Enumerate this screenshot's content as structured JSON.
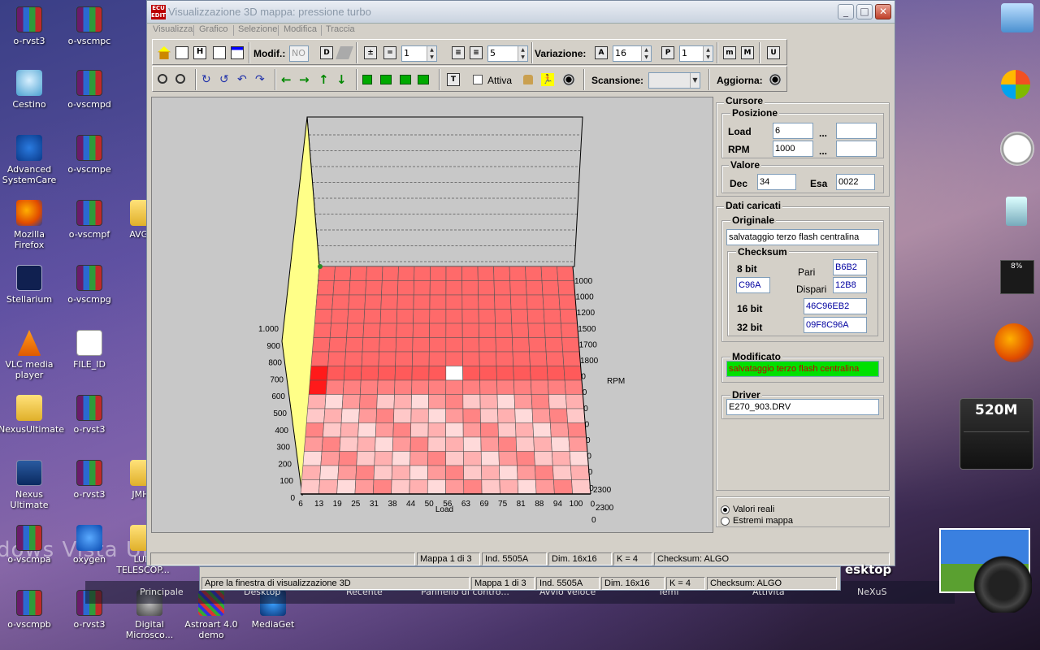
{
  "window": {
    "title": "Visualizzazione 3D mappa: pressione turbo",
    "app_icon_text": "ECU EDIT"
  },
  "menu": [
    "Visualizza",
    "Grafico",
    "Selezione",
    "Modifica",
    "Traccia"
  ],
  "toolbar1": {
    "modif_label": "Modif.:",
    "modif_value": "NO",
    "spin1_value": "1",
    "spin2_value": "5",
    "variazione_label": "Variazione:",
    "variazione_value": "16",
    "p_value": "1"
  },
  "toolbar2": {
    "attiva_label": "Attiva",
    "scansione_label": "Scansione:",
    "scansione_value": "",
    "aggiorna_label": "Aggiorna:"
  },
  "chart_data": {
    "type": "3d-surface",
    "z_ticks": [
      "0",
      "100",
      "200",
      "300",
      "400",
      "500",
      "600",
      "700",
      "800",
      "900",
      "1.000"
    ],
    "load_ticks": [
      "6",
      "13",
      "19",
      "25",
      "31",
      "38",
      "44",
      "50",
      "56",
      "63",
      "69",
      "75",
      "81",
      "88",
      "94",
      "100"
    ],
    "xlabel": "Load",
    "rpm_ticks": [
      "1000",
      "1000",
      "1200",
      "1500",
      "1700",
      "1800",
      "0",
      "0",
      "0",
      "0",
      "0",
      "0",
      "0",
      "0",
      "0",
      "0",
      "2300",
      "2300"
    ],
    "ylabel": "RPM"
  },
  "cursore": {
    "title": "Cursore",
    "posizione_title": "Posizione",
    "load_label": "Load",
    "load_value": "6",
    "load_to": "",
    "rpm_label": "RPM",
    "rpm_value": "1000",
    "rpm_to": "",
    "ellipsis": "...",
    "valore_title": "Valore",
    "dec_label": "Dec",
    "dec_value": "34",
    "esa_label": "Esa",
    "esa_value": "0022"
  },
  "dati": {
    "title": "Dati caricati",
    "originale_title": "Originale",
    "originale_value": "salvataggio terzo flash centralina",
    "checksum_title": "Checksum",
    "bit8_label": "8 bit",
    "pari_label": "Pari",
    "pari_value": "B6B2",
    "bit8_value": "C96A",
    "dispari_label": "Dispari",
    "dispari_value": "12B8",
    "bit16_label": "16 bit",
    "bit16_value": "46C96EB2",
    "bit32_label": "32 bit",
    "bit32_value": "09F8C96A",
    "modificato_title": "Modificato",
    "modificato_value": "salvataggio terzo flash centralina",
    "driver_title": "Driver",
    "driver_value": "E270_903.DRV"
  },
  "view_mode": {
    "options": [
      "Valori reali",
      "Estremi mappa"
    ],
    "selected": 0
  },
  "status": {
    "mappa": "Mappa 1 di 3",
    "ind": "Ind. 5505A",
    "dim": "Dim. 16x16",
    "k": "K = 4",
    "checksum": "Checksum: ALGO"
  },
  "status2": {
    "hint": "Apre la finestra di visualizzazione 3D",
    "mappa": "Mappa 1 di 3",
    "ind": "Ind. 5505A",
    "dim": "Dim. 16x16",
    "k": "K = 4",
    "checksum": "Checksum: ALGO"
  },
  "desktop": {
    "brand_text": "dows Vista Ultim",
    "icons": [
      {
        "label": "o-rvst3"
      },
      {
        "label": "o-vscmpc"
      },
      {
        "label": "Cestino"
      },
      {
        "label": "o-vscmpd"
      },
      {
        "label": "Advanced SystemCare"
      },
      {
        "label": "o-vscmpe"
      },
      {
        "label": "Mozilla Firefox"
      },
      {
        "label": "o-vscmpf"
      },
      {
        "label": "AVG..."
      },
      {
        "label": "Stellarium"
      },
      {
        "label": "o-vscmpg"
      },
      {
        "label": "VLC media player"
      },
      {
        "label": "FILE_ID"
      },
      {
        "label": "NexusUltimate"
      },
      {
        "label": "o-rvst3"
      },
      {
        "label": "Nexus Ultimate"
      },
      {
        "label": "o-rvst3"
      },
      {
        "label": "JMHL"
      },
      {
        "label": "o-vscmpa"
      },
      {
        "label": "oxygen"
      },
      {
        "label": "LUM TELESCOP..."
      },
      {
        "label": "o-vscmpb"
      },
      {
        "label": "o-rvst3"
      },
      {
        "label": "Digital Microsco..."
      },
      {
        "label": "Astroart 4.0 demo"
      },
      {
        "label": "MediaGet"
      }
    ],
    "taskbar": [
      "Principale",
      "Desktop",
      "Recente",
      "Pannello di contro...",
      "Avvio Veloce",
      "Temi",
      "Attività",
      "NeXuS"
    ],
    "taskbar_right": "esktop",
    "cpu_meter": "8%",
    "ram_meter": "520M"
  },
  "colors": {
    "surface_red": "#ff5a5a",
    "surface_pink": "#ffc8c8",
    "modified_bg": "#00e000",
    "modified_text": "#c00000"
  }
}
